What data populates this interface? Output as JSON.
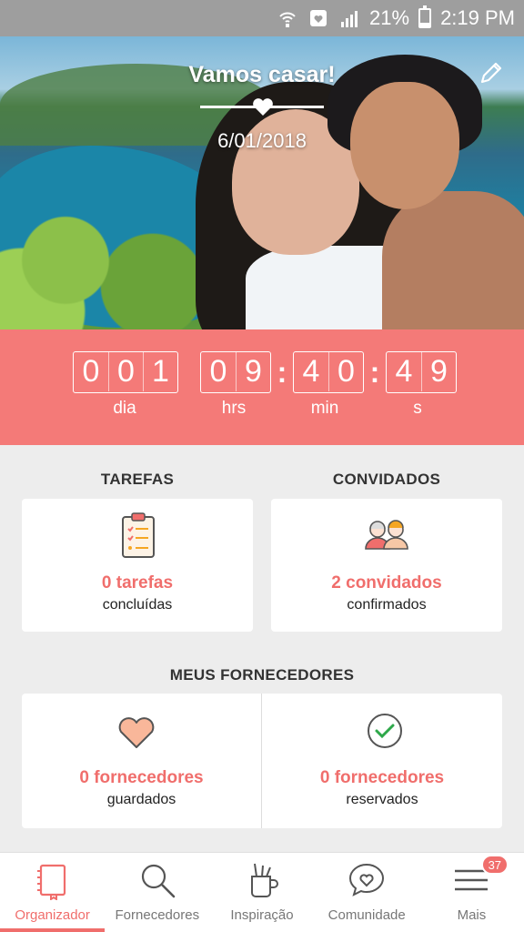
{
  "status_bar": {
    "battery": "21%",
    "time": "2:19 PM",
    "battery_level": 0.21
  },
  "hero": {
    "title": "Vamos casar!",
    "date": "6/01/2018"
  },
  "countdown": {
    "days": [
      "0",
      "0",
      "1"
    ],
    "hours": [
      "0",
      "9"
    ],
    "minutes": [
      "4",
      "0"
    ],
    "seconds": [
      "4",
      "9"
    ],
    "labels": {
      "days": "dia",
      "hours": "hrs",
      "minutes": "min",
      "seconds": "s"
    }
  },
  "tasks": {
    "title": "TAREFAS",
    "count": "0 tarefas",
    "sub": "concluídas"
  },
  "guests": {
    "title": "CONVIDADOS",
    "count": "2 convidados",
    "sub": "confirmados"
  },
  "vendors": {
    "title": "MEUS FORNECEDORES",
    "saved": {
      "count": "0 fornecedores",
      "sub": "guardados"
    },
    "booked": {
      "count": "0 fornecedores",
      "sub": "reservados"
    }
  },
  "nav": {
    "items": [
      {
        "label": "Organizador",
        "icon": "notebook-icon",
        "active": true
      },
      {
        "label": "Fornecedores",
        "icon": "search-icon"
      },
      {
        "label": "Inspiração",
        "icon": "cup-icon"
      },
      {
        "label": "Comunidade",
        "icon": "chat-heart-icon"
      },
      {
        "label": "Mais",
        "icon": "menu-icon"
      }
    ],
    "badge": "37"
  },
  "colors": {
    "accent": "#f47a78",
    "status_bar": "#9e9e9e"
  }
}
